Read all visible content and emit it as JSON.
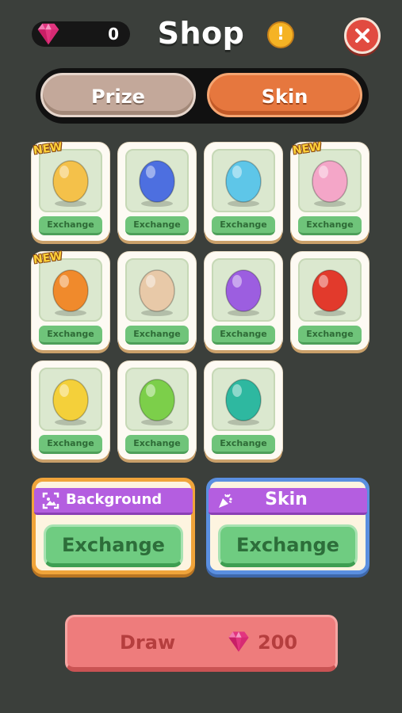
{
  "header": {
    "gem_count": "0",
    "title": "Shop",
    "info_symbol": "!"
  },
  "tabs": [
    {
      "label": "Prize",
      "active": false
    },
    {
      "label": "Skin",
      "active": true
    }
  ],
  "skins": [
    {
      "name": "spotted-egg-icon",
      "is_new": true,
      "new_label": "NEW",
      "button": "Exchange",
      "color": "#f4c14a"
    },
    {
      "name": "blue-egg-icon",
      "is_new": false,
      "button": "Exchange",
      "color": "#4d6fe0"
    },
    {
      "name": "cyan-swirl-egg-icon",
      "is_new": false,
      "button": "Exchange",
      "color": "#5ec6e8"
    },
    {
      "name": "pink-egg-icon",
      "is_new": true,
      "new_label": "NEW",
      "button": "Exchange",
      "color": "#f4a6c8"
    },
    {
      "name": "burger-monster-icon",
      "is_new": true,
      "new_label": "NEW",
      "button": "Exchange",
      "color": "#f08a2c"
    },
    {
      "name": "bird-egg-icon",
      "is_new": false,
      "button": "Exchange",
      "color": "#e8c9a8"
    },
    {
      "name": "purple-monster-icon",
      "is_new": false,
      "button": "Exchange",
      "color": "#9c5ee0"
    },
    {
      "name": "red-dragon-icon",
      "is_new": false,
      "button": "Exchange",
      "color": "#e23a2c"
    },
    {
      "name": "yellow-dino-icon",
      "is_new": false,
      "button": "Exchange",
      "color": "#f4d03a"
    },
    {
      "name": "green-dino-icon",
      "is_new": false,
      "button": "Exchange",
      "color": "#7ccf4a"
    },
    {
      "name": "teal-dino-icon",
      "is_new": false,
      "button": "Exchange",
      "color": "#2eb8a0"
    }
  ],
  "exchange_panels": {
    "background": {
      "title": "Background",
      "button": "Exchange"
    },
    "skin": {
      "title": "Skin",
      "button": "Exchange"
    }
  },
  "draw": {
    "label": "Draw",
    "price": "200"
  },
  "colors": {
    "background": "#3b3f3b",
    "accent_orange": "#e6773e",
    "exchange_green": "#6fc47a",
    "draw_red": "#ee7c7c"
  }
}
